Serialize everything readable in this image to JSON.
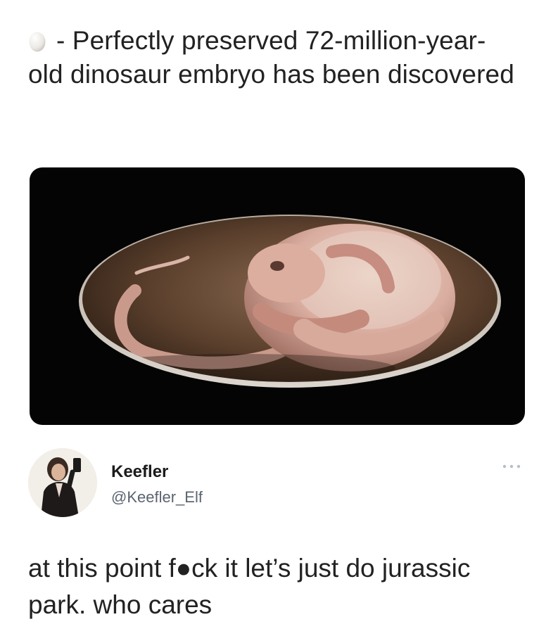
{
  "quoted_post": {
    "text": "- Perfectly preserved 72-million-year-old dinosaur embryo has been discovered",
    "emoji_icon": "egg-icon",
    "media_description_icon": "dinosaur-embryo-in-egg-image"
  },
  "tweet": {
    "author": {
      "display_name": "Keefler",
      "handle": "@Keefler_Elf",
      "avatar_icon": "person-taking-mirror-selfie-avatar"
    },
    "more_icon": "more-options-icon",
    "text": "at this point f●ck it let’s just do jurassic park. who cares"
  },
  "colors": {
    "background": "#ffffff",
    "text": "#222222",
    "handle_text": "#5b6470",
    "media_background": "#050404"
  }
}
